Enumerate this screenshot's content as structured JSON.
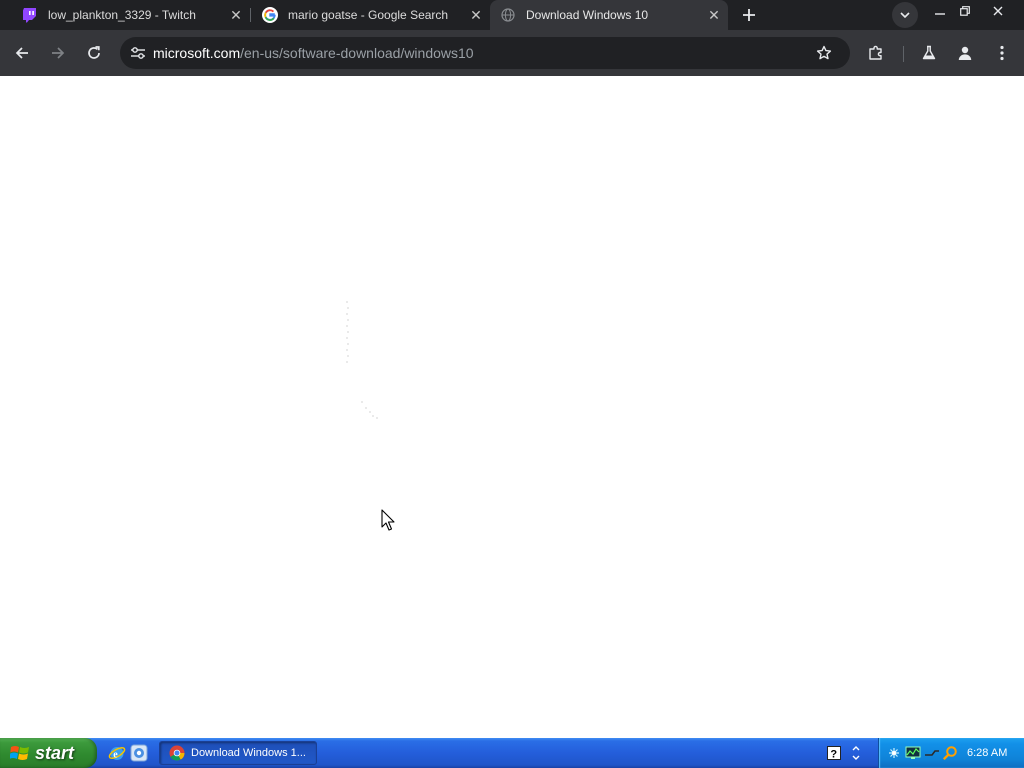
{
  "browser": {
    "tabs": [
      {
        "title": "low_plankton_3329 - Twitch",
        "favicon": "twitch-icon",
        "active": false
      },
      {
        "title": "mario goatse - Google Search",
        "favicon": "google-icon",
        "active": false
      },
      {
        "title": "Download Windows 10",
        "favicon": "globe-icon",
        "active": true
      }
    ],
    "address_bar": {
      "host": "microsoft.com",
      "path": "/en-us/software-download/windows10"
    },
    "colors": {
      "frame": "#202124",
      "toolbar": "#35363a",
      "omnibox": "#202124"
    }
  },
  "page": {
    "state": "loading",
    "background": "#ffffff"
  },
  "taskbar": {
    "start_label": "start",
    "task_button_label": "Download Windows 1...",
    "clock": "6:28 AM",
    "colors": {
      "taskbar": "#245edb",
      "start": "#3c9a3c",
      "tray": "#0f83d8"
    }
  }
}
